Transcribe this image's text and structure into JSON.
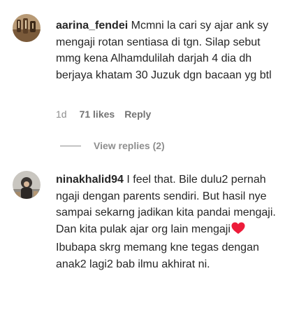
{
  "comments": [
    {
      "username": "aarina_fendei",
      "text": "Mcmni la cari sy ajar ank sy mengaji rotan sentiasa di tgn. Silap sebut mmg kena Alhamdulilah darjah 4 dia dh berjaya khatam 30 Juzuk dgn bacaan yg btl",
      "time": "1d",
      "likes": "71 likes",
      "reply_label": "Reply",
      "view_replies_label": "View replies (2)"
    },
    {
      "username": "ninakhalid94",
      "text": "I feel that. Bile dulu2 pernah ngaji dengan parents sendiri. But hasil nye sampai sekarng jadikan kita pandai mengaji. Dan kita pulak ajar org lain mengaji",
      "text_after_emoji": "Ibubapa skrg memang kne tegas dengan anak2 lagi2 bab ilmu akhirat ni.",
      "emoji": "red-heart-icon"
    }
  ],
  "colors": {
    "text": "#262626",
    "secondary": "#8e8e8e",
    "heart": "#ed1c3a"
  }
}
